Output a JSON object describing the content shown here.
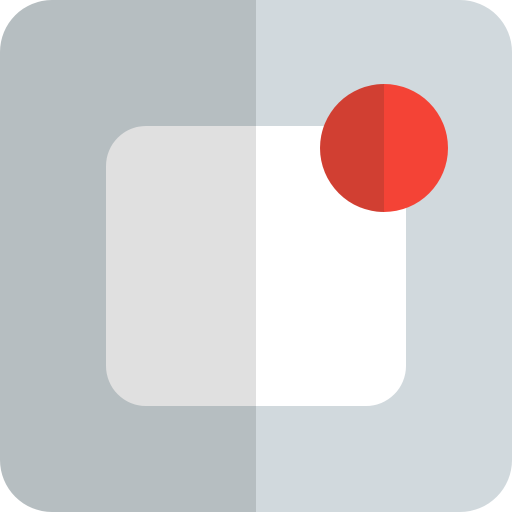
{
  "icon": {
    "name": "notification-badge-icon",
    "colors": {
      "outer_left": "#b6bec1",
      "outer_right": "#d1d9dd",
      "inner_left": "#e0e0e0",
      "inner_right": "#ffffff",
      "badge_left": "#d13f32",
      "badge_right": "#f44336"
    }
  }
}
